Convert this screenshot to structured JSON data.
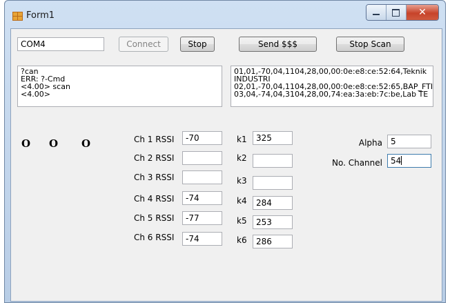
{
  "window": {
    "title": "Form1"
  },
  "top_row": {
    "port_value": "COM4",
    "connect_label": "Connect",
    "stop_label": "Stop",
    "send_label": "Send $$$",
    "stop_scan_label": "Stop Scan"
  },
  "log": {
    "left_lines": "?can\nERR: ?-Cmd\n<4.00> scan\n<4.00>",
    "right_lines": "01,01,-70,04,1104,28,00,00:0e:e8:ce:52:64,Teknik INDUSTRI\n02,01,-70,04,1104,28,00,00:0e:e8:ce:52:65,BAP_FTI\n03,04,-74,04,3104,28,00,74:ea:3a:eb:7c:be,Lab TE"
  },
  "indicators": [
    "O",
    "O",
    "O"
  ],
  "channels": [
    {
      "label": "Ch 1 RSSI",
      "rssi": "-70",
      "k_label": "k1",
      "k_value": "325"
    },
    {
      "label": "Ch 2 RSSI",
      "rssi": "",
      "k_label": "k2",
      "k_value": ""
    },
    {
      "label": "Ch 3 RSSI",
      "rssi": "",
      "k_label": "k3",
      "k_value": ""
    },
    {
      "label": "Ch 4 RSSI",
      "rssi": "-74",
      "k_label": "k4",
      "k_value": "284"
    },
    {
      "label": "Ch 5 RSSI",
      "rssi": "-77",
      "k_label": "k5",
      "k_value": "253"
    },
    {
      "label": "Ch 6 RSSI",
      "rssi": "-74",
      "k_label": "k6",
      "k_value": "286"
    }
  ],
  "params": {
    "alpha_label": "Alpha",
    "alpha_value": "5",
    "channel_label": "No. Channel",
    "channel_value": "54"
  }
}
